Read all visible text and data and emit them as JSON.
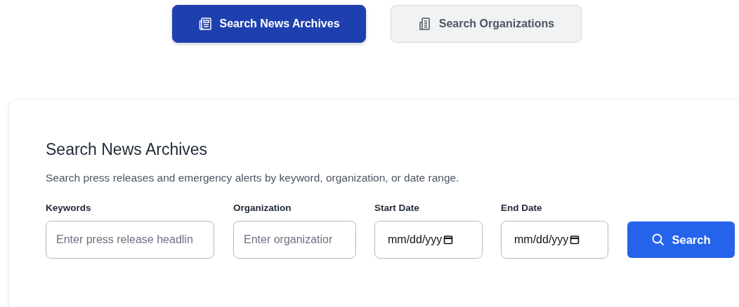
{
  "tabs": [
    {
      "label": "Search News Archives",
      "kind": "news",
      "selected": true
    },
    {
      "label": "Search Organizations",
      "kind": "building",
      "selected": false
    }
  ],
  "panel": {
    "title": "Search News Archives",
    "description": "Search press releases and emergency alerts by keyword, organization, or date range.",
    "fields": [
      {
        "label": "Keywords",
        "kind": "text",
        "placeholder": "Enter press release headlin"
      },
      {
        "label": "Organization",
        "kind": "text",
        "placeholder": "Enter organizatior"
      },
      {
        "label": "Start Date",
        "kind": "date",
        "value": "mm/dd/yyy"
      },
      {
        "label": "End Date",
        "kind": "date",
        "value": "mm/dd/yyy"
      }
    ],
    "search_button": "Search"
  }
}
